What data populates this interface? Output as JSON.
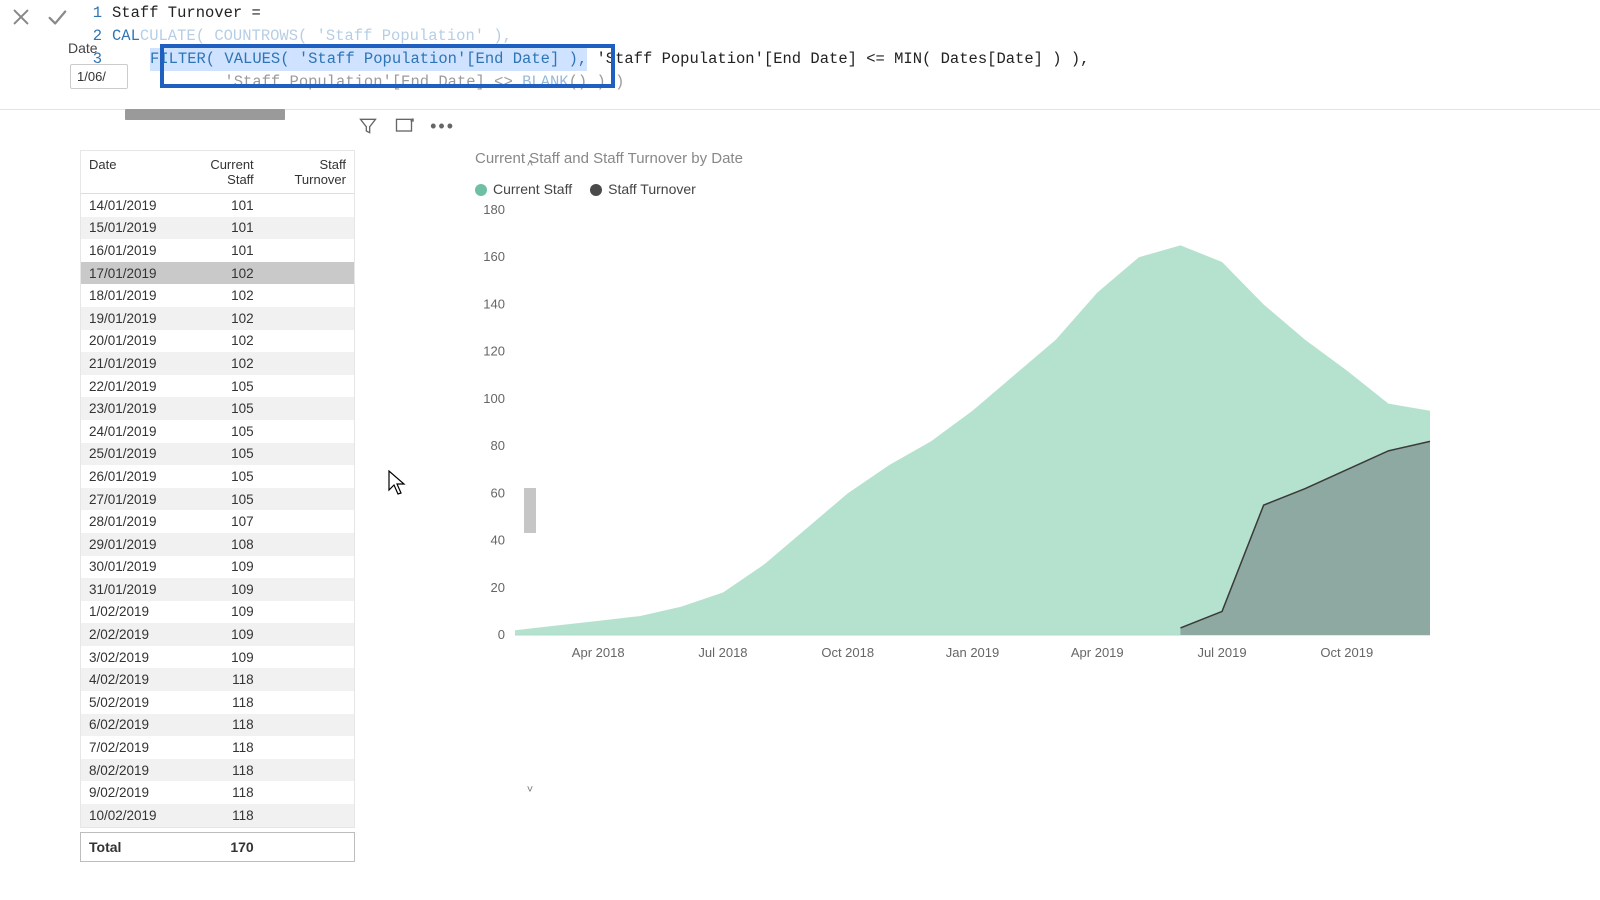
{
  "formula": {
    "measure_name": "Staff Turnover =",
    "line2_pre": "CAL",
    "line2_mid": "CULATE( COUNTROWS( 'Staff Population' ),",
    "line3_hi": "FILTER( VALUES( 'Staff Population'[End Date] ),",
    "line3_rest": " 'Staff Population'[End Date] <= MIN( Dates[Date] ) ),",
    "line4_pre": "        'Staff Population'[End Date] <> ",
    "line4_fn": "BLANK",
    "line4_post": "() ) )",
    "slicer_label": "Date",
    "slicer_value": "1/06/"
  },
  "table": {
    "hdr_date": "Date",
    "hdr_cs": "Current Staff",
    "hdr_st": "Staff Turnover",
    "rows": [
      {
        "date": "14/01/2019",
        "cs": "101",
        "st": ""
      },
      {
        "date": "15/01/2019",
        "cs": "101",
        "st": ""
      },
      {
        "date": "16/01/2019",
        "cs": "101",
        "st": ""
      },
      {
        "date": "17/01/2019",
        "cs": "102",
        "st": ""
      },
      {
        "date": "18/01/2019",
        "cs": "102",
        "st": ""
      },
      {
        "date": "19/01/2019",
        "cs": "102",
        "st": ""
      },
      {
        "date": "20/01/2019",
        "cs": "102",
        "st": ""
      },
      {
        "date": "21/01/2019",
        "cs": "102",
        "st": ""
      },
      {
        "date": "22/01/2019",
        "cs": "105",
        "st": ""
      },
      {
        "date": "23/01/2019",
        "cs": "105",
        "st": ""
      },
      {
        "date": "24/01/2019",
        "cs": "105",
        "st": ""
      },
      {
        "date": "25/01/2019",
        "cs": "105",
        "st": ""
      },
      {
        "date": "26/01/2019",
        "cs": "105",
        "st": ""
      },
      {
        "date": "27/01/2019",
        "cs": "105",
        "st": ""
      },
      {
        "date": "28/01/2019",
        "cs": "107",
        "st": ""
      },
      {
        "date": "29/01/2019",
        "cs": "108",
        "st": ""
      },
      {
        "date": "30/01/2019",
        "cs": "109",
        "st": ""
      },
      {
        "date": "31/01/2019",
        "cs": "109",
        "st": ""
      },
      {
        "date": "1/02/2019",
        "cs": "109",
        "st": ""
      },
      {
        "date": "2/02/2019",
        "cs": "109",
        "st": ""
      },
      {
        "date": "3/02/2019",
        "cs": "109",
        "st": ""
      },
      {
        "date": "4/02/2019",
        "cs": "118",
        "st": ""
      },
      {
        "date": "5/02/2019",
        "cs": "118",
        "st": ""
      },
      {
        "date": "6/02/2019",
        "cs": "118",
        "st": ""
      },
      {
        "date": "7/02/2019",
        "cs": "118",
        "st": ""
      },
      {
        "date": "8/02/2019",
        "cs": "118",
        "st": ""
      },
      {
        "date": "9/02/2019",
        "cs": "118",
        "st": ""
      },
      {
        "date": "10/02/2019",
        "cs": "118",
        "st": ""
      }
    ],
    "total_label": "Total",
    "total_cs": "170"
  },
  "chart_data": {
    "type": "area",
    "title": "Current Staff and Staff Turnover by Date",
    "legend": [
      "Current Staff",
      "Staff Turnover"
    ],
    "ylabel": "",
    "xlabel": "",
    "ylim": [
      0,
      180
    ],
    "y_ticks": [
      0,
      20,
      40,
      60,
      80,
      100,
      120,
      140,
      160,
      180
    ],
    "x_ticks": [
      "Apr 2018",
      "Jul 2018",
      "Oct 2018",
      "Jan 2019",
      "Apr 2019",
      "Jul 2019",
      "Oct 2019"
    ],
    "x": [
      "Feb 2018",
      "Mar 2018",
      "Apr 2018",
      "May 2018",
      "Jun 2018",
      "Jul 2018",
      "Aug 2018",
      "Sep 2018",
      "Oct 2018",
      "Nov 2018",
      "Dec 2018",
      "Jan 2019",
      "Feb 2019",
      "Mar 2019",
      "Apr 2019",
      "May 2019",
      "Jun 2019",
      "Jul 2019",
      "Aug 2019",
      "Sep 2019",
      "Oct 2019",
      "Nov 2019",
      "Dec 2019"
    ],
    "series": [
      {
        "name": "Current Staff",
        "values": [
          2,
          4,
          6,
          8,
          12,
          18,
          30,
          45,
          60,
          72,
          82,
          95,
          110,
          125,
          145,
          160,
          165,
          158,
          140,
          125,
          112,
          98,
          95
        ]
      },
      {
        "name": "Staff Turnover",
        "values": [
          null,
          null,
          null,
          null,
          null,
          null,
          null,
          null,
          null,
          null,
          null,
          null,
          null,
          null,
          null,
          null,
          3,
          10,
          55,
          62,
          70,
          78,
          82
        ]
      }
    ]
  }
}
